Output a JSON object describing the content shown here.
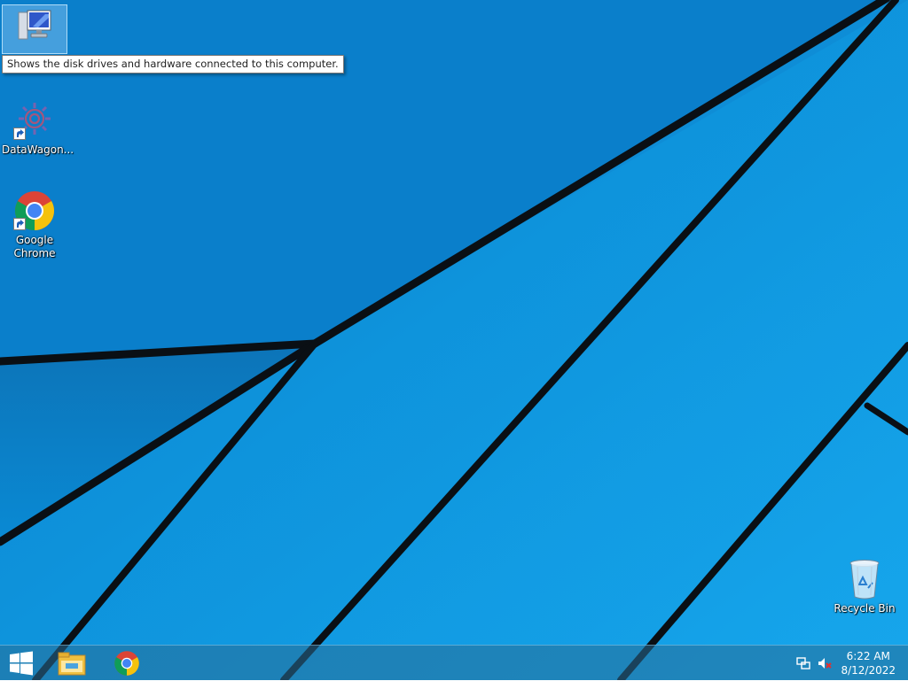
{
  "desktop": {
    "icons": [
      {
        "label": "",
        "icon": "this-pc-icon"
      },
      {
        "label": "DataWagon...",
        "icon": "gear-app-icon"
      },
      {
        "label": "Google\nChrome",
        "icon": "chrome-icon"
      },
      {
        "label": "Recycle Bin",
        "icon": "recycle-bin-icon"
      }
    ],
    "tooltip": "Shows the disk drives and hardware connected to this computer."
  },
  "taskbar": {
    "pinned": [
      "windows-start-icon",
      "file-explorer-icon",
      "chrome-icon"
    ],
    "tray": [
      "network-icon",
      "volume-muted-icon"
    ],
    "time": "6:22 AM",
    "date": "8/12/2022"
  },
  "colors": {
    "wallpaper_top": "#0a77c4",
    "wallpaper_main": "#0d9de6",
    "wallpaper_light": "#1aa8ec",
    "tooltip_bg": "#ffffff"
  }
}
